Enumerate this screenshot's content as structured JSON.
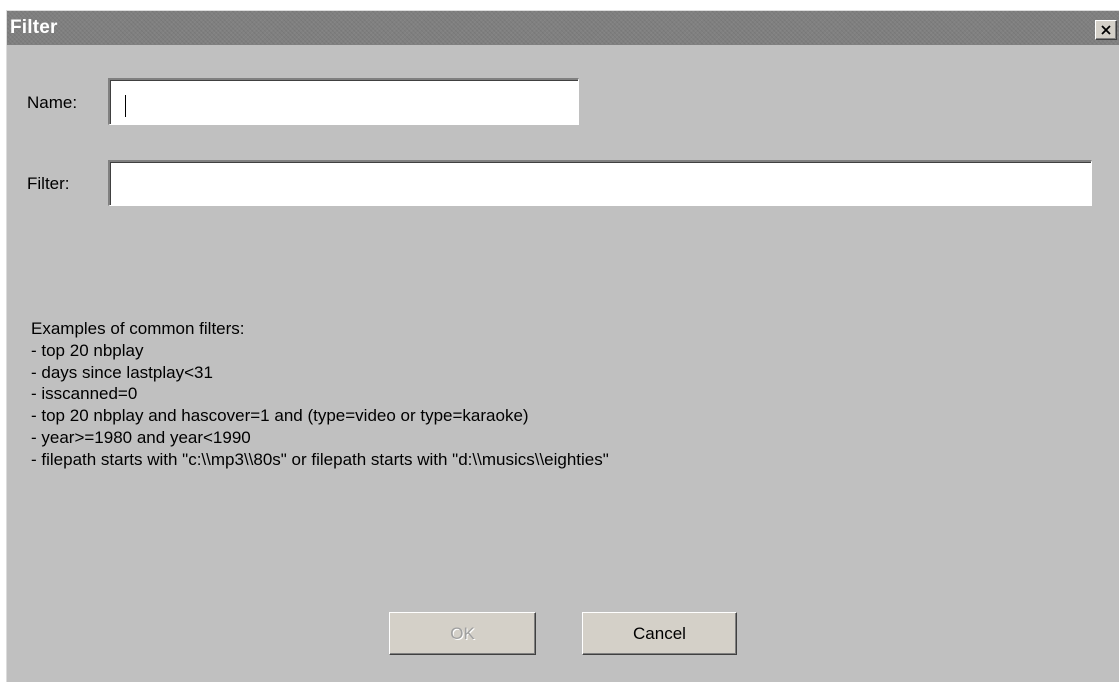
{
  "dialog": {
    "title": "Filter",
    "close_icon": "close-x-icon"
  },
  "form": {
    "name_label": "Name:",
    "name_value": "",
    "filter_label": "Filter:",
    "filter_value": ""
  },
  "examples": {
    "heading": "Examples of common filters:",
    "items": [
      "- top 20 nbplay",
      "- days since lastplay<31",
      "- isscanned=0",
      "- top 20 nbplay and hascover=1 and (type=video or type=karaoke)",
      "- year>=1980 and year<1990",
      "- filepath starts with \"c:\\\\mp3\\\\80s\" or filepath starts with \"d:\\\\musics\\\\eighties\""
    ]
  },
  "buttons": {
    "ok_label": "OK",
    "ok_enabled": false,
    "cancel_label": "Cancel"
  }
}
